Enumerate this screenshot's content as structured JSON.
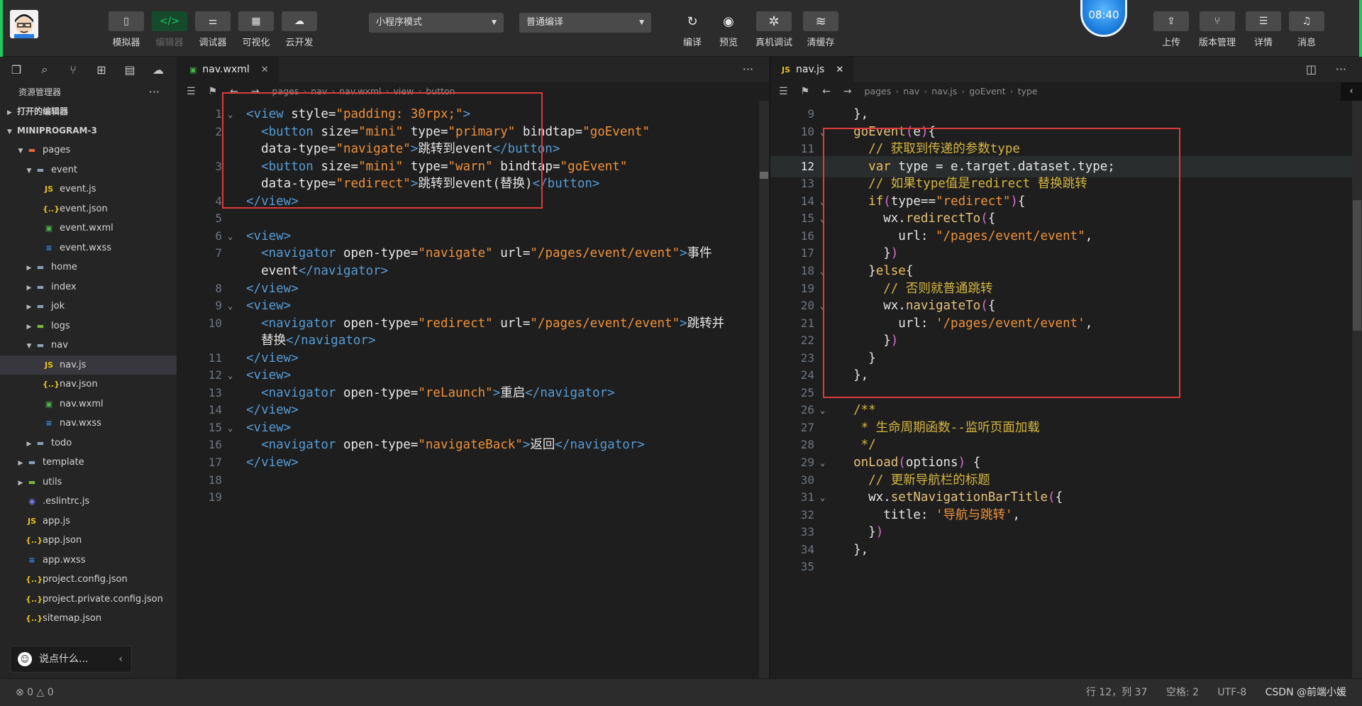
{
  "toolbar": {
    "tools": [
      {
        "label": "模拟器",
        "icon": "phone-icon"
      },
      {
        "label": "编辑器",
        "icon": "code-icon"
      },
      {
        "label": "调试器",
        "icon": "sliders-icon"
      },
      {
        "label": "可视化",
        "icon": "layout-icon"
      },
      {
        "label": "云开发",
        "icon": "cloud-icon"
      }
    ],
    "mode_select": "小程序模式",
    "compile_select": "普通编译",
    "actions": [
      {
        "label": "编译",
        "icon": "refresh-icon"
      },
      {
        "label": "预览",
        "icon": "eye-icon"
      },
      {
        "label": "真机调试",
        "icon": "bug-icon"
      },
      {
        "label": "清缓存",
        "icon": "layers-icon"
      }
    ],
    "clock": "08:40",
    "right_actions": [
      {
        "label": "上传",
        "icon": "upload-icon"
      },
      {
        "label": "版本管理",
        "icon": "branch-icon"
      },
      {
        "label": "详情",
        "icon": "menu-icon"
      },
      {
        "label": "消息",
        "icon": "bell-icon"
      }
    ]
  },
  "sidebar": {
    "title": "资源管理器",
    "sections": {
      "open_editors": "打开的编辑器",
      "project": "MINIPROGRAM-3"
    },
    "tree": [
      {
        "label": "pages",
        "depth": 1,
        "type": "folder-red",
        "arrow": "▼"
      },
      {
        "label": "event",
        "depth": 2,
        "type": "folder",
        "arrow": "▼"
      },
      {
        "label": "event.js",
        "depth": 3,
        "type": "js"
      },
      {
        "label": "event.json",
        "depth": 3,
        "type": "json"
      },
      {
        "label": "event.wxml",
        "depth": 3,
        "type": "wxml"
      },
      {
        "label": "event.wxss",
        "depth": 3,
        "type": "wxss"
      },
      {
        "label": "home",
        "depth": 2,
        "type": "folder",
        "arrow": "▶"
      },
      {
        "label": "index",
        "depth": 2,
        "type": "folder",
        "arrow": "▶"
      },
      {
        "label": "jok",
        "depth": 2,
        "type": "folder",
        "arrow": "▶"
      },
      {
        "label": "logs",
        "depth": 2,
        "type": "folder-green",
        "arrow": "▶"
      },
      {
        "label": "nav",
        "depth": 2,
        "type": "folder",
        "arrow": "▼"
      },
      {
        "label": "nav.js",
        "depth": 3,
        "type": "js",
        "selected": true
      },
      {
        "label": "nav.json",
        "depth": 3,
        "type": "json"
      },
      {
        "label": "nav.wxml",
        "depth": 3,
        "type": "wxml"
      },
      {
        "label": "nav.wxss",
        "depth": 3,
        "type": "wxss"
      },
      {
        "label": "todo",
        "depth": 2,
        "type": "folder",
        "arrow": "▶"
      },
      {
        "label": "template",
        "depth": 1,
        "type": "folder",
        "arrow": "▶"
      },
      {
        "label": "utils",
        "depth": 1,
        "type": "folder-green",
        "arrow": "▶"
      },
      {
        "label": ".eslintrc.js",
        "depth": 1,
        "type": "eslint"
      },
      {
        "label": "app.js",
        "depth": 1,
        "type": "js"
      },
      {
        "label": "app.json",
        "depth": 1,
        "type": "json"
      },
      {
        "label": "app.wxss",
        "depth": 1,
        "type": "wxss"
      },
      {
        "label": "project.config.json",
        "depth": 1,
        "type": "json"
      },
      {
        "label": "project.private.config.json",
        "depth": 1,
        "type": "json"
      },
      {
        "label": "sitemap.json",
        "depth": 1,
        "type": "json"
      }
    ],
    "chat_placeholder": "说点什么..."
  },
  "left_editor": {
    "tab": "nav.wxml",
    "breadcrumb": [
      "pages",
      "nav",
      "nav.wxml",
      "view",
      "button"
    ],
    "lines": [
      {
        "n": "1",
        "fold": true,
        "parts": [
          [
            "tag",
            "<view "
          ],
          [
            "attr",
            "style="
          ],
          [
            "str",
            "\"padding: 30rpx;\""
          ],
          [
            "tag",
            ">"
          ]
        ]
      },
      {
        "n": "2",
        "parts": [
          [
            "txt",
            "  "
          ],
          [
            "tag",
            "<button "
          ],
          [
            "attr",
            "size="
          ],
          [
            "str",
            "\"mini\""
          ],
          [
            "attr",
            " type="
          ],
          [
            "str",
            "\"primary\""
          ],
          [
            "attr",
            " bindtap="
          ],
          [
            "str",
            "\"goEvent\""
          ]
        ]
      },
      {
        "n": "",
        "parts": [
          [
            "txt",
            "  "
          ],
          [
            "attr",
            "data-type="
          ],
          [
            "str",
            "\"navigate\""
          ],
          [
            "tag",
            ">"
          ],
          [
            "txt",
            "跳转到event"
          ],
          [
            "tag",
            "</button>"
          ]
        ]
      },
      {
        "n": "3",
        "parts": [
          [
            "txt",
            "  "
          ],
          [
            "tag",
            "<button "
          ],
          [
            "attr",
            "size="
          ],
          [
            "str",
            "\"mini\""
          ],
          [
            "attr",
            " type="
          ],
          [
            "str",
            "\"warn\""
          ],
          [
            "attr",
            " bindtap="
          ],
          [
            "str",
            "\"goEvent\""
          ]
        ]
      },
      {
        "n": "",
        "parts": [
          [
            "txt",
            "  "
          ],
          [
            "attr",
            "data-type="
          ],
          [
            "str",
            "\"redirect\""
          ],
          [
            "tag",
            ">"
          ],
          [
            "txt",
            "跳转到event(替换)"
          ],
          [
            "tag",
            "</button>"
          ]
        ]
      },
      {
        "n": "4",
        "parts": [
          [
            "tag",
            "</view>"
          ]
        ]
      },
      {
        "n": "5",
        "parts": []
      },
      {
        "n": "6",
        "fold": true,
        "parts": [
          [
            "tag",
            "<view>"
          ]
        ]
      },
      {
        "n": "7",
        "parts": [
          [
            "txt",
            "  "
          ],
          [
            "tag",
            "<navigator "
          ],
          [
            "attr",
            "open-type="
          ],
          [
            "str",
            "\"navigate\""
          ],
          [
            "attr",
            " url="
          ],
          [
            "str",
            "\"/pages/event/event\""
          ],
          [
            "tag",
            ">"
          ],
          [
            "txt",
            "事件"
          ]
        ]
      },
      {
        "n": "",
        "parts": [
          [
            "txt",
            "  event"
          ],
          [
            "tag",
            "</navigator>"
          ]
        ]
      },
      {
        "n": "8",
        "parts": [
          [
            "tag",
            "</view>"
          ]
        ]
      },
      {
        "n": "9",
        "fold": true,
        "parts": [
          [
            "tag",
            "<view>"
          ]
        ]
      },
      {
        "n": "10",
        "parts": [
          [
            "txt",
            "  "
          ],
          [
            "tag",
            "<navigator "
          ],
          [
            "attr",
            "open-type="
          ],
          [
            "str",
            "\"redirect\""
          ],
          [
            "attr",
            " url="
          ],
          [
            "str",
            "\"/pages/event/event\""
          ],
          [
            "tag",
            ">"
          ],
          [
            "txt",
            "跳转并"
          ]
        ]
      },
      {
        "n": "",
        "parts": [
          [
            "txt",
            "  替换"
          ],
          [
            "tag",
            "</navigator>"
          ]
        ]
      },
      {
        "n": "11",
        "parts": [
          [
            "tag",
            "</view>"
          ]
        ]
      },
      {
        "n": "12",
        "fold": true,
        "parts": [
          [
            "tag",
            "<view>"
          ]
        ]
      },
      {
        "n": "13",
        "parts": [
          [
            "txt",
            "  "
          ],
          [
            "tag",
            "<navigator "
          ],
          [
            "attr",
            "open-type="
          ],
          [
            "str",
            "\"reLaunch\""
          ],
          [
            "tag",
            ">"
          ],
          [
            "txt",
            "重启"
          ],
          [
            "tag",
            "</navigator>"
          ]
        ]
      },
      {
        "n": "14",
        "parts": [
          [
            "tag",
            "</view>"
          ]
        ]
      },
      {
        "n": "15",
        "fold": true,
        "parts": [
          [
            "tag",
            "<view>"
          ]
        ]
      },
      {
        "n": "16",
        "parts": [
          [
            "txt",
            "  "
          ],
          [
            "tag",
            "<navigator "
          ],
          [
            "attr",
            "open-type="
          ],
          [
            "str",
            "\"navigateBack\""
          ],
          [
            "tag",
            ">"
          ],
          [
            "txt",
            "返回"
          ],
          [
            "tag",
            "</navigator>"
          ]
        ]
      },
      {
        "n": "17",
        "parts": [
          [
            "tag",
            "</view>"
          ]
        ]
      },
      {
        "n": "18",
        "parts": []
      },
      {
        "n": "19",
        "parts": []
      }
    ]
  },
  "right_editor": {
    "tab": "nav.js",
    "breadcrumb": [
      "pages",
      "nav",
      "nav.js",
      "goEvent",
      "type"
    ],
    "lines": [
      {
        "n": "9",
        "parts": [
          [
            "txt",
            "  },"
          ]
        ]
      },
      {
        "n": "10",
        "fold": true,
        "parts": [
          [
            "txt",
            "  "
          ],
          [
            "fn",
            "goEvent"
          ],
          [
            "br",
            "("
          ],
          [
            "prop",
            "e"
          ],
          [
            "br",
            ")"
          ],
          [
            "txt",
            "{"
          ]
        ]
      },
      {
        "n": "11",
        "parts": [
          [
            "txt",
            "    "
          ],
          [
            "cm",
            "// 获取到传递的参数type"
          ]
        ]
      },
      {
        "n": "12",
        "cur": true,
        "parts": [
          [
            "txt",
            "    "
          ],
          [
            "kw",
            "var"
          ],
          [
            "txt",
            " type = e.target.dataset.type;"
          ]
        ]
      },
      {
        "n": "13",
        "parts": [
          [
            "txt",
            "    "
          ],
          [
            "cm",
            "// 如果type值是redirect 替换跳转"
          ]
        ]
      },
      {
        "n": "14",
        "fold": true,
        "parts": [
          [
            "txt",
            "    "
          ],
          [
            "kw",
            "if"
          ],
          [
            "br",
            "("
          ],
          [
            "txt",
            "type=="
          ],
          [
            "str",
            "\"redirect\""
          ],
          [
            "br",
            ")"
          ],
          [
            "txt",
            "{"
          ]
        ]
      },
      {
        "n": "15",
        "fold": true,
        "parts": [
          [
            "txt",
            "      wx."
          ],
          [
            "fn",
            "redirectTo"
          ],
          [
            "br",
            "("
          ],
          [
            "txt",
            "{"
          ]
        ]
      },
      {
        "n": "16",
        "parts": [
          [
            "txt",
            "        url: "
          ],
          [
            "str",
            "\"/pages/event/event\""
          ],
          [
            "txt",
            ","
          ]
        ]
      },
      {
        "n": "17",
        "parts": [
          [
            "txt",
            "      }"
          ],
          [
            "br",
            ")"
          ]
        ]
      },
      {
        "n": "18",
        "fold": true,
        "parts": [
          [
            "txt",
            "    }"
          ],
          [
            "kw",
            "else"
          ],
          [
            "txt",
            "{"
          ]
        ]
      },
      {
        "n": "19",
        "parts": [
          [
            "txt",
            "      "
          ],
          [
            "cm",
            "// 否则就普通跳转"
          ]
        ]
      },
      {
        "n": "20",
        "fold": true,
        "parts": [
          [
            "txt",
            "      wx."
          ],
          [
            "fn",
            "navigateTo"
          ],
          [
            "br",
            "("
          ],
          [
            "txt",
            "{"
          ]
        ]
      },
      {
        "n": "21",
        "parts": [
          [
            "txt",
            "        url: "
          ],
          [
            "str",
            "'/pages/event/event'"
          ],
          [
            "txt",
            ","
          ]
        ]
      },
      {
        "n": "22",
        "parts": [
          [
            "txt",
            "      }"
          ],
          [
            "br",
            ")"
          ]
        ]
      },
      {
        "n": "23",
        "parts": [
          [
            "txt",
            "    }"
          ]
        ]
      },
      {
        "n": "24",
        "parts": [
          [
            "txt",
            "  },"
          ]
        ]
      },
      {
        "n": "25",
        "parts": []
      },
      {
        "n": "26",
        "fold": true,
        "parts": [
          [
            "txt",
            "  "
          ],
          [
            "cm",
            "/**"
          ]
        ]
      },
      {
        "n": "27",
        "parts": [
          [
            "txt",
            "   "
          ],
          [
            "cm",
            "* 生命周期函数--监听页面加载"
          ]
        ]
      },
      {
        "n": "28",
        "parts": [
          [
            "txt",
            "   "
          ],
          [
            "cm",
            "*/"
          ]
        ]
      },
      {
        "n": "29",
        "fold": true,
        "parts": [
          [
            "txt",
            "  "
          ],
          [
            "fn",
            "onLoad"
          ],
          [
            "br",
            "("
          ],
          [
            "prop",
            "options"
          ],
          [
            "br",
            ")"
          ],
          [
            "txt",
            " {"
          ]
        ]
      },
      {
        "n": "30",
        "parts": [
          [
            "txt",
            "    "
          ],
          [
            "cm",
            "// 更新导航栏的标题"
          ]
        ]
      },
      {
        "n": "31",
        "fold": true,
        "parts": [
          [
            "txt",
            "    wx."
          ],
          [
            "fn",
            "setNavigationBarTitle"
          ],
          [
            "br",
            "("
          ],
          [
            "txt",
            "{"
          ]
        ]
      },
      {
        "n": "32",
        "parts": [
          [
            "txt",
            "      title: "
          ],
          [
            "str",
            "'导航与跳转'"
          ],
          [
            "txt",
            ","
          ]
        ]
      },
      {
        "n": "33",
        "parts": [
          [
            "txt",
            "    }"
          ],
          [
            "br",
            ")"
          ]
        ]
      },
      {
        "n": "34",
        "parts": [
          [
            "txt",
            "  },"
          ]
        ]
      },
      {
        "n": "35",
        "parts": []
      }
    ]
  },
  "status": {
    "errors": "⊗ 0 △ 0",
    "position": "行 12，列 37",
    "spaces": "空格: 2",
    "encoding": "UTF-8",
    "watermark": "CSDN @前端小媛"
  }
}
